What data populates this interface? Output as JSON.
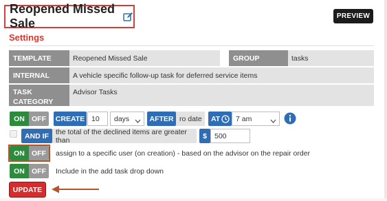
{
  "header": {
    "title": "Reopened Missed Sale",
    "preview_label": "PREVIEW"
  },
  "settings": {
    "heading": "Settings",
    "template_label": "TEMPLATE",
    "template_value": "Reopened Missed Sale",
    "group_label": "GROUP",
    "group_value": "tasks",
    "internal_label": "INTERNAL",
    "internal_value": "A vehicle specific follow-up task for deferred service items",
    "task_category_label": "TASK CATEGORY",
    "task_category_value": "Advisor Tasks"
  },
  "schedule_row": {
    "on_label": "ON",
    "off_label": "OFF",
    "create_label": "CREATE",
    "create_value": "10",
    "unit_value": "days",
    "after_label": "AFTER",
    "after_value": "ro date",
    "at_label": "AT",
    "time_value": "7 am"
  },
  "condition_row": {
    "and_if_label": "AND IF",
    "condition_text": "the total of the declined items are greater than",
    "currency_symbol": "$",
    "amount_value": "500"
  },
  "assign_row": {
    "on_label": "ON",
    "off_label": "OFF",
    "text": "assign to a specific user (on creation) - based on the advisor on the repair order"
  },
  "dropdown_row": {
    "on_label": "ON",
    "off_label": "OFF",
    "text": "Include in the add task drop down"
  },
  "footer": {
    "update_label": "UPDATE"
  },
  "colors": {
    "accent_red": "#d9342b",
    "toggle_on_green": "#2e8b3e",
    "toggle_off_grey": "#9a9a9a",
    "action_blue": "#2f6db5"
  },
  "icons": [
    "edit-icon",
    "clock-icon",
    "info-icon",
    "chevron-down-icon",
    "checkbox-icon",
    "arrow-left-icon"
  ]
}
